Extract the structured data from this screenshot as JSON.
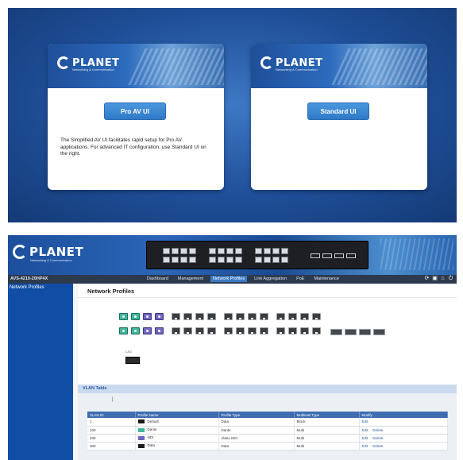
{
  "selection": {
    "cards": [
      {
        "brand": "PLANET",
        "tagline": "Networking & Communication",
        "button": "Pro AV UI",
        "description": "The Simplified AV UI facilitates rapid setup for Pro AV applications. For advanced IT configuration, use Standard UI on the right."
      },
      {
        "brand": "PLANET",
        "tagline": "Networking & Communication",
        "button": "Standard UI",
        "description": ""
      }
    ]
  },
  "app": {
    "brand": "PLANET",
    "tagline": "Networking & Communication",
    "model": "AVS-4210-20HP4X",
    "nav": [
      {
        "label": "Dashboard"
      },
      {
        "label": "Management"
      },
      {
        "label": "Network Profiles"
      },
      {
        "label": "Link Aggregation"
      },
      {
        "label": "PoE"
      },
      {
        "label": "Maintenance"
      }
    ],
    "sidebar": {
      "item": "Network Profiles"
    },
    "content": {
      "title": "Network Profiles",
      "lag_label": "LAG"
    },
    "vlan": {
      "section_title": "VLAN Table",
      "columns": [
        "VLAN ID",
        "Profile Name",
        "Profile Type",
        "Multicast Type",
        "Modify"
      ],
      "rows": [
        {
          "id": "1",
          "color": "#1c1c1c",
          "name": "Default",
          "type": "Data",
          "mc": "Block",
          "edit": "Edit",
          "delete": ""
        },
        {
          "id": "100",
          "color": "#3fb59c",
          "name": "Dante",
          "type": "Dante",
          "mc": "Multi",
          "edit": "Edit",
          "delete": "Delete"
        },
        {
          "id": "200",
          "color": "#6f66c2",
          "name": "NDI",
          "type": "Video NDI",
          "mc": "Multi",
          "edit": "Edit",
          "delete": "Delete"
        },
        {
          "id": "300",
          "color": "#1c1c1c",
          "name": "Data",
          "type": "Data",
          "mc": "Multi",
          "edit": "Edit",
          "delete": "Delete"
        }
      ]
    },
    "tool_icons": [
      "refresh-icon",
      "save-icon",
      "home-icon",
      "logout-icon"
    ]
  }
}
